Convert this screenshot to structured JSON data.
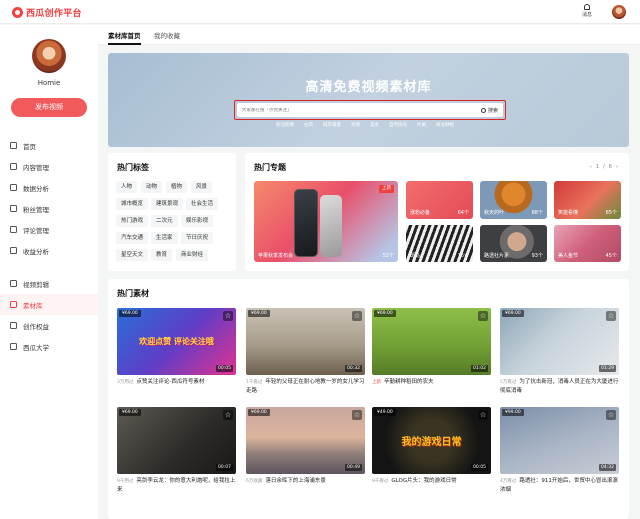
{
  "app": {
    "logo_text": "西瓜创作平台",
    "message_label": "消息"
  },
  "user": {
    "name": "Homie",
    "publish_button": "发布视频"
  },
  "nav": {
    "items": [
      {
        "label": "首页",
        "icon": "home-icon"
      },
      {
        "label": "内容管理",
        "icon": "content-icon"
      },
      {
        "label": "数据分析",
        "icon": "chart-icon"
      },
      {
        "label": "粉丝管理",
        "icon": "fans-icon"
      },
      {
        "label": "评论管理",
        "icon": "comment-icon"
      },
      {
        "label": "收益分析",
        "icon": "income-icon"
      }
    ],
    "items2": [
      {
        "label": "视频剪辑",
        "icon": "video-edit-icon"
      },
      {
        "label": "素材库",
        "icon": "library-icon",
        "active": true
      },
      {
        "label": "创作权益",
        "icon": "benefit-icon"
      },
      {
        "label": "西瓜大学",
        "icon": "university-icon"
      }
    ]
  },
  "tabs": [
    {
      "label": "素材库首页",
      "active": true
    },
    {
      "label": "我的收藏"
    }
  ],
  "banner": {
    "title": "高清免费视频素材库",
    "search_placeholder": "大家都在搜「点赞关注」",
    "search_button": "搜索",
    "hotwords": [
      "新冠疫情",
      "古风",
      "城市夜景",
      "亲情",
      "美女",
      "自然风光",
      "片尾",
      "商业财经"
    ]
  },
  "hot_tags": {
    "title": "热门标签",
    "tags": [
      "人物",
      "动物",
      "植物",
      "风景",
      "城市概览",
      "建筑景观",
      "社会生活",
      "热门游戏",
      "二次元",
      "娱乐影视",
      "汽车交通",
      "生活家",
      "节日庆祝",
      "星空天文",
      "教育",
      "商业财经"
    ]
  },
  "hot_topics": {
    "title": "热门专题",
    "pager": "1 / 6",
    "main": {
      "label": "苹果秋季发布会",
      "count": "52个",
      "badge": "上新"
    },
    "items": [
      {
        "label": "涨粉必备",
        "count": "64个"
      },
      {
        "label": "秋天的叶",
        "count": "88个"
      },
      {
        "label": "笑能看懂",
        "count": "85个"
      },
      {
        "label": "斑马",
        "count": "76个"
      },
      {
        "label": "路透社片素",
        "count": "93个"
      },
      {
        "label": "美人鱼节",
        "count": "45个"
      }
    ]
  },
  "hot_materials": {
    "title": "热门素材",
    "cards": [
      {
        "price": "¥69.00",
        "dur": "00:05",
        "uses": "3万用过",
        "title": "点赞关注评论-西瓜符号素材",
        "thumb_text": "欢迎点赞 评论关注哦"
      },
      {
        "price": "¥69.00",
        "dur": "00:32",
        "uses": "1千看过",
        "title": "年轻的父母正在耐心地教一岁的女儿学习走路"
      },
      {
        "price": "¥69.00",
        "dur": "01:02",
        "uses": "上新",
        "uses_new": true,
        "title": "辛勤耕种稻田的农夫"
      },
      {
        "price": "¥69.00",
        "dur": "01:29",
        "uses": "5万看过",
        "title": "为了抗击新冠，消毒人员正在为大厦进行彻底消毒"
      },
      {
        "price": "¥69.00",
        "dur": "00:07",
        "uses": "9千用过",
        "title": "亮剑李云龙：你的意大利炮呢，给我拉上来"
      },
      {
        "price": "¥69.00",
        "dur": "00:49",
        "uses": "6万收藏",
        "title": "落日余晖下的上海浦东景"
      },
      {
        "price": "¥49.00",
        "dur": "00:05",
        "uses": "9千看过",
        "title": "GLOG片头：我的游戏日常",
        "thumb_text": "我的游戏日常"
      },
      {
        "price": "¥99.00",
        "dur": "04:32",
        "uses": "4万看过",
        "title": "路透社：911开始后，世贸中心冒出滚滚浓烟"
      }
    ]
  },
  "colors": {
    "accent": "#f04142",
    "banner": "#b8c9d8"
  }
}
